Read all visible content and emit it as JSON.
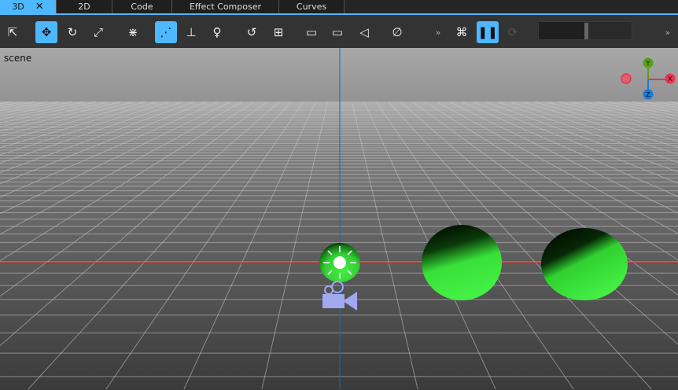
{
  "tabs": [
    {
      "label": "3D",
      "active": true,
      "close": "✕"
    },
    {
      "label": "2D"
    },
    {
      "label": "Code"
    },
    {
      "label": "Effect Composer"
    },
    {
      "label": "Curves"
    }
  ],
  "toolbar": {
    "tools": [
      {
        "name": "select-icon",
        "glyph": "⇱"
      },
      {
        "name": "move-icon",
        "glyph": "✥",
        "active": true
      },
      {
        "name": "rotate-icon",
        "glyph": "↻"
      },
      {
        "name": "scale-icon",
        "glyph": "⤢"
      },
      {
        "name": "fit-icon",
        "glyph": "⋇"
      },
      {
        "name": "pivot-icon",
        "glyph": "⋰",
        "active": true
      },
      {
        "name": "axes-icon",
        "glyph": "⊥"
      },
      {
        "name": "light-icon",
        "glyph": "♀"
      },
      {
        "name": "snap-icon",
        "glyph": "↺"
      },
      {
        "name": "ruler-icon",
        "glyph": "⊞"
      },
      {
        "name": "camera-view-icon",
        "glyph": "▭"
      },
      {
        "name": "edit-camera-icon",
        "glyph": "▭"
      },
      {
        "name": "camera-align-icon",
        "glyph": "◁"
      },
      {
        "name": "visibility-icon",
        "glyph": "∅"
      },
      {
        "name": "more-icon",
        "glyph": "»"
      },
      {
        "name": "particles-icon",
        "glyph": "⌘"
      },
      {
        "name": "pause-icon",
        "glyph": "❚❚",
        "active": true
      },
      {
        "name": "reset-icon",
        "glyph": "⟳",
        "dim": true
      },
      {
        "name": "overflow-icon",
        "glyph": "»"
      }
    ],
    "slider_value": 0.5
  },
  "viewport": {
    "label": "scene",
    "gizmo": {
      "x": "X",
      "y": "Y",
      "z": "Z"
    }
  },
  "colors": {
    "accent": "#4db8ff",
    "x": "#e8344e",
    "y": "#58a01c",
    "z": "#1a7ad8",
    "sphere": "#3ee83e"
  }
}
